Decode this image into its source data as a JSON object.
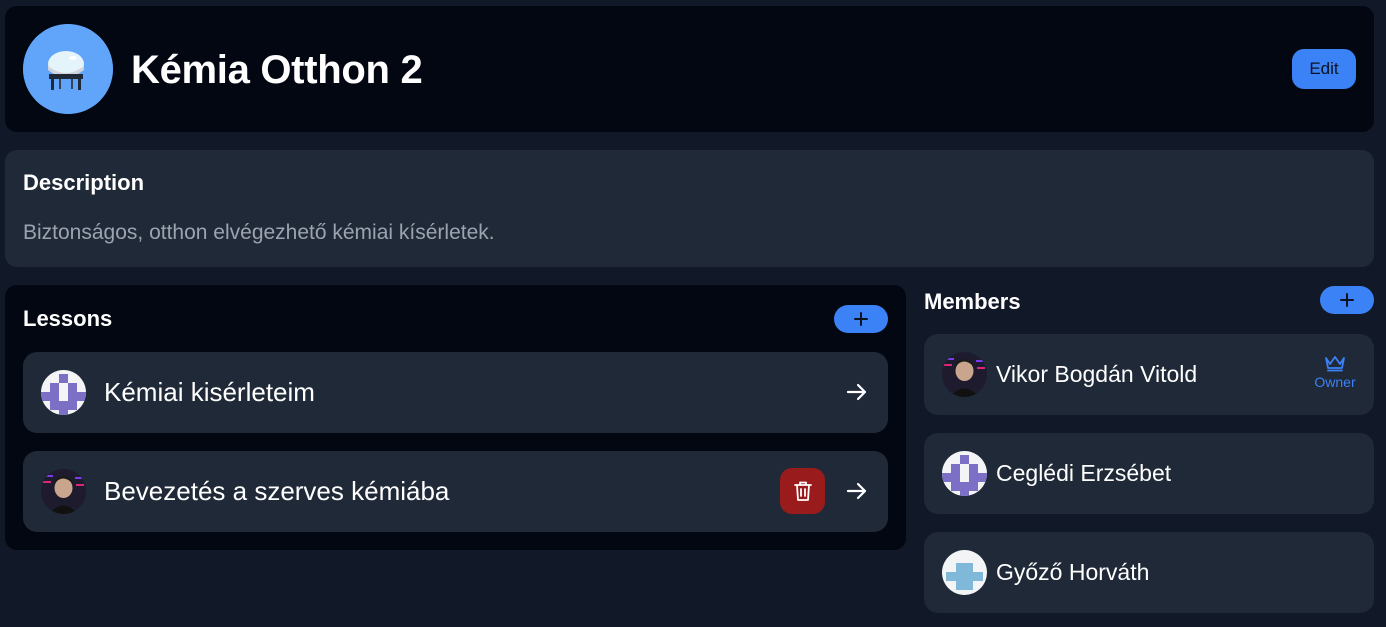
{
  "header": {
    "title": "Kémia Otthon 2",
    "edit_label": "Edit",
    "avatar_icon": "lab-apparatus-icon",
    "avatar_color": "#60a5fa"
  },
  "description": {
    "title": "Description",
    "text": "Biztonságos, otthon elvégezhető kémiai kísérletek."
  },
  "lessons": {
    "title": "Lessons",
    "add_icon": "plus-icon",
    "items": [
      {
        "label": "Kémiai kisérleteim",
        "avatar": "purple-pattern-avatar",
        "deletable": false
      },
      {
        "label": "Bevezetés a szerves kémiába",
        "avatar": "photo-avatar",
        "deletable": true
      }
    ]
  },
  "members": {
    "title": "Members",
    "add_icon": "plus-icon",
    "items": [
      {
        "name": "Vikor Bogdán Vitold",
        "avatar": "photo-avatar",
        "role": "Owner"
      },
      {
        "name": "Ceglédi Erzsébet",
        "avatar": "purple-pattern-avatar"
      },
      {
        "name": "Győző Horváth",
        "avatar": "blue-pattern-avatar"
      }
    ]
  },
  "colors": {
    "page_bg": "#111827",
    "panel_dark": "#030712",
    "card": "#1f2937",
    "accent": "#3b82f6",
    "danger": "#991b1b",
    "muted_text": "#9ca3af"
  }
}
